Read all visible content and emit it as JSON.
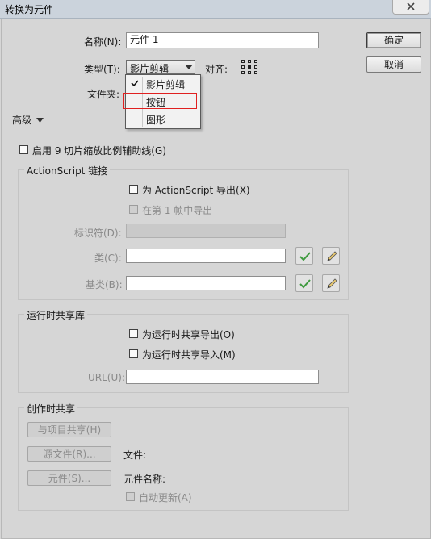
{
  "window": {
    "title": "转换为元件"
  },
  "form": {
    "name_label": "名称(N):",
    "name_value": "元件 1",
    "type_label": "类型(T):",
    "type_value": "影片剪辑",
    "align_label": "对齐:",
    "folder_label": "文件夹:",
    "advanced_label": "高级"
  },
  "dropdown": {
    "options": [
      "影片剪辑",
      "按钮",
      "图形"
    ],
    "selected_index": 0,
    "highlighted_index": 1,
    "highlight_color": "#e02020"
  },
  "buttons": {
    "ok": "确定",
    "cancel": "取消"
  },
  "nine_slice": {
    "label": "启用 9 切片缩放比例辅助线(G)",
    "checked": false
  },
  "actionscript": {
    "title": "ActionScript 链接",
    "export_label": "为 ActionScript 导出(X)",
    "first_frame_label": "在第 1 帧中导出",
    "identifier_label": "标识符(D):",
    "class_label": "类(C):",
    "base_class_label": "基类(B):"
  },
  "runtime_shared": {
    "title": "运行时共享库",
    "export_label": "为运行时共享导出(O)",
    "import_label": "为运行时共享导入(M)",
    "url_label": "URL(U):"
  },
  "authortime_shared": {
    "title": "创作时共享",
    "share_button": "与项目共享(H)",
    "source_button": "源文件(R)...",
    "file_label": "文件:",
    "symbol_button": "元件(S)...",
    "symbol_name_label": "元件名称:",
    "auto_update_label": "自动更新(A)"
  },
  "colors": {
    "check_green": "#3f9a3f",
    "dialog_bg": "#d6d6d6"
  }
}
